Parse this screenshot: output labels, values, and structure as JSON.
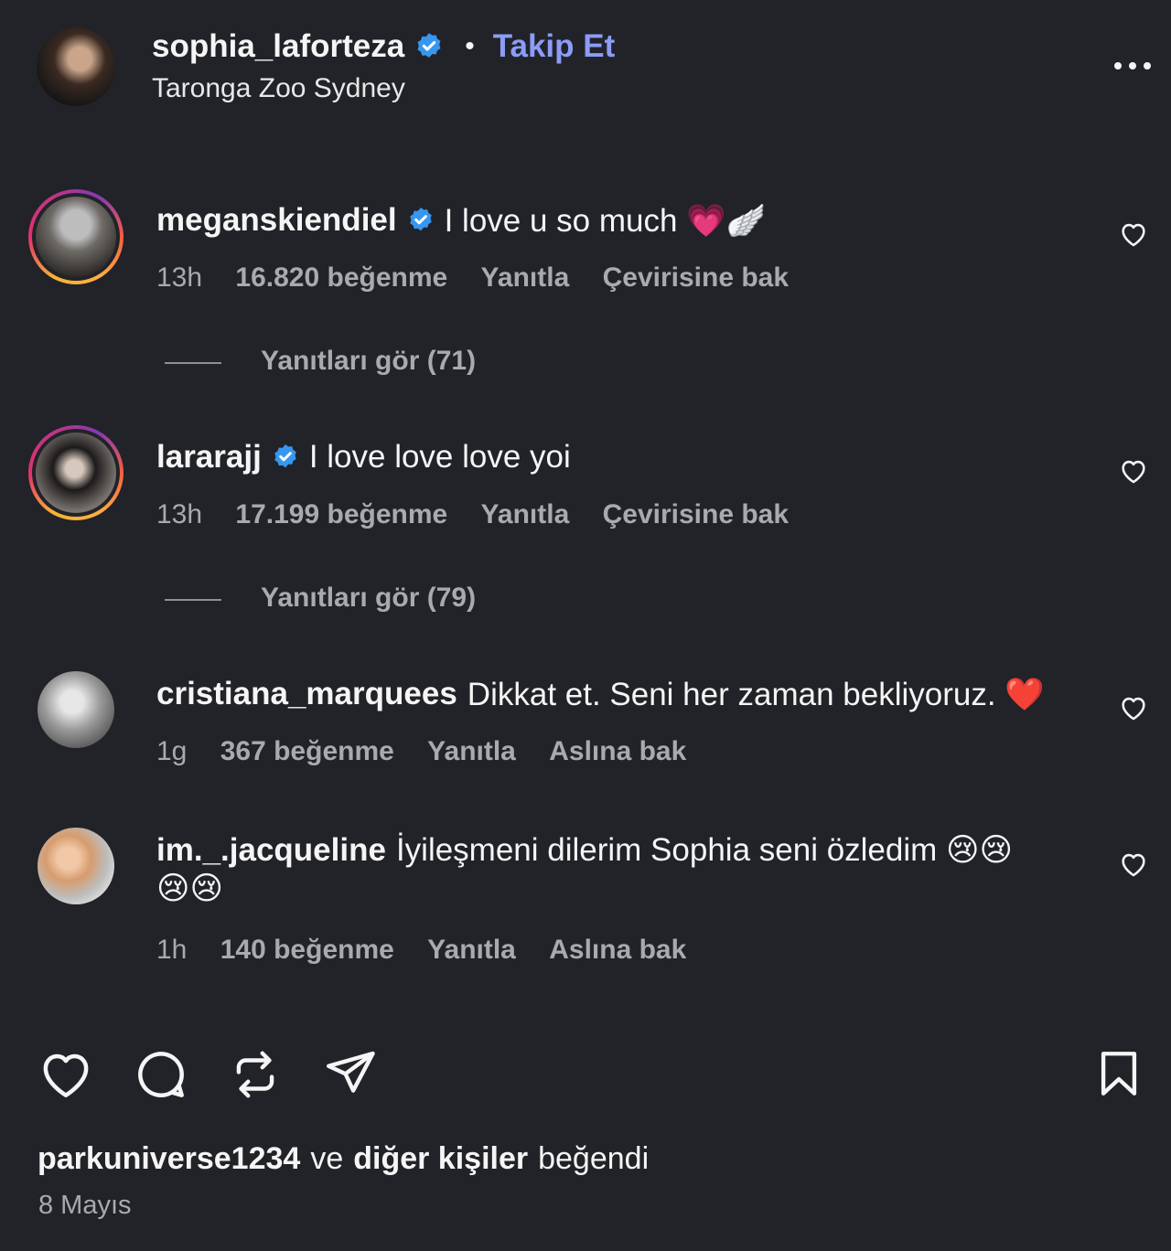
{
  "header": {
    "username": "sophia_laforteza",
    "separator": "•",
    "follow_label": "Takip Et",
    "location": "Taronga Zoo Sydney",
    "more_icon": "more-horizontal-icon"
  },
  "comments": [
    {
      "username": "meganskiendiel",
      "verified": true,
      "text": "I love u so much 💗🪽",
      "time": "13h",
      "likes": "16.820 beğenme",
      "reply": "Yanıtla",
      "translate": "Çevirisine bak",
      "view_replies": "Yanıtları gör (71)"
    },
    {
      "username": "lararajj",
      "verified": true,
      "text": "I love love love yoi",
      "time": "13h",
      "likes": "17.199 beğenme",
      "reply": "Yanıtla",
      "translate": "Çevirisine bak",
      "view_replies": "Yanıtları gör (79)"
    },
    {
      "username": "cristiana_marquees",
      "verified": false,
      "text": "Dikkat et. Seni her zaman bekliyoruz. ❤️",
      "time": "1g",
      "likes": "367 beğenme",
      "reply": "Yanıtla",
      "translate": "Aslına bak"
    },
    {
      "username": "im._.jacqueline",
      "verified": false,
      "text_line1": "İyileşmeni dilerim Sophia seni özledim 😢😢",
      "text_line2": "😢😢",
      "time": "1h",
      "likes": "140 beğenme",
      "reply": "Yanıtla",
      "translate": "Aslına bak"
    }
  ],
  "actions": {
    "like_icon": "heart-icon",
    "comment_icon": "comment-icon",
    "repost_icon": "repost-icon",
    "share_icon": "send-icon",
    "save_icon": "bookmark-icon"
  },
  "liked_by": {
    "user": "parkuniverse1234",
    "connector": "ve",
    "others": "diğer kişiler",
    "suffix": "beğendi"
  },
  "date": "8 Mayıs",
  "colors": {
    "background": "#212328",
    "follow": "#8c9cf7",
    "verified": "#3797f0",
    "muted": "#a8aab0"
  }
}
